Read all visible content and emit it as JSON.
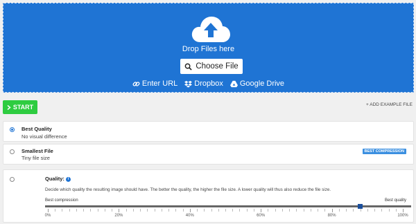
{
  "upload": {
    "drop_text": "Drop Files here",
    "choose_label": "Choose File",
    "sources": [
      {
        "icon": "link-icon",
        "label": "Enter URL"
      },
      {
        "icon": "dropbox-icon",
        "label": "Dropbox"
      },
      {
        "icon": "google-drive-icon",
        "label": "Google Drive"
      }
    ],
    "background_color": "#1f74d4"
  },
  "actions": {
    "start_label": "START",
    "start_color": "#2ecc40",
    "add_example_label": "+ ADD EXAMPLE FILE"
  },
  "options": [
    {
      "title": "Best Quality",
      "subtitle": "No visual difference",
      "selected": true
    },
    {
      "title": "Smallest File",
      "subtitle": "Tiny file size",
      "selected": false,
      "badge": "BEST COMPRESSION"
    }
  ],
  "quality": {
    "title": "Quality:",
    "description": "Decide which quality the resulting image should have. The better the quality, the higher the file size. A lower quality will thus also reduce the file size.",
    "left_label": "Best compression",
    "right_label": "Best quality",
    "value_percent": 86,
    "tick_labels": [
      "0%",
      "20%",
      "40%",
      "60%",
      "80%",
      "100%"
    ]
  }
}
